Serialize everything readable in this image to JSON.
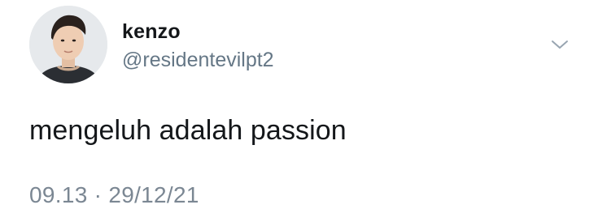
{
  "tweet": {
    "author": {
      "display_name": "kenzo",
      "handle": "@residentevilpt2",
      "avatar_icon": "profile-photo"
    },
    "menu_icon": "chevron-down-icon",
    "text": "mengeluh adalah passion",
    "timestamp": "09.13 · 29/12/21"
  },
  "colors": {
    "primary_text": "#14171a",
    "secondary_text": "#657786",
    "background": "#ffffff"
  }
}
